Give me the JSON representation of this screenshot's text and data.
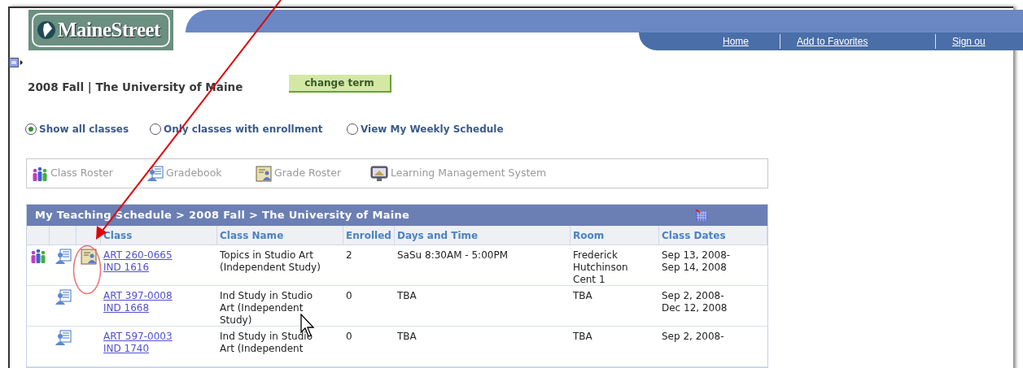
{
  "header": {
    "logo": "MaineStreet",
    "nav_links": [
      "Home",
      "Add to Favorites",
      "Sign ou"
    ]
  },
  "term": {
    "title": "2008 Fall | The University of Maine",
    "button": "change term"
  },
  "view_options": [
    {
      "label": "Show all classes",
      "selected": true
    },
    {
      "label": "Only classes with enrollment",
      "selected": false
    },
    {
      "label": "View My Weekly Schedule",
      "selected": false
    }
  ],
  "legend": [
    {
      "kind": "roster",
      "label": "Class Roster"
    },
    {
      "kind": "gradebook",
      "label": "Gradebook"
    },
    {
      "kind": "grade_roster",
      "label": "Grade Roster"
    },
    {
      "kind": "lms",
      "label": "Learning Management System"
    }
  ],
  "table": {
    "title": "My Teaching Schedule > 2008 Fall > The University of Maine",
    "columns": [
      "Class",
      "Class Name",
      "Enrolled",
      "Days and Time",
      "Room",
      "Class Dates"
    ],
    "rows": [
      {
        "roster": true,
        "gradebook": true,
        "grade_roster": true,
        "class": [
          "ART 260-0665",
          "IND 1616"
        ],
        "class_name": "Topics in Studio Art (Independent Study)",
        "enrolled": "2",
        "days_time": "SaSu 8:30AM - 5:00PM",
        "room": "Frederick Hutchinson Cent 1",
        "dates": [
          "Sep 13, 2008-",
          "Sep 14, 2008"
        ]
      },
      {
        "roster": false,
        "gradebook": true,
        "grade_roster": false,
        "class": [
          "ART 397-0008",
          "IND 1668"
        ],
        "class_name": "Ind Study in Studio Art (Independent Study)",
        "enrolled": "0",
        "days_time": "TBA",
        "room": "TBA",
        "dates": [
          "Sep 2, 2008-",
          "Dec 12, 2008"
        ]
      },
      {
        "roster": false,
        "gradebook": true,
        "grade_roster": false,
        "class": [
          "ART 597-0003",
          "IND 1740"
        ],
        "class_name": "Ind Study in Studio Art (Independent",
        "enrolled": "0",
        "days_time": "TBA",
        "room": "TBA",
        "dates": [
          "Sep 2, 2008-"
        ]
      }
    ]
  }
}
